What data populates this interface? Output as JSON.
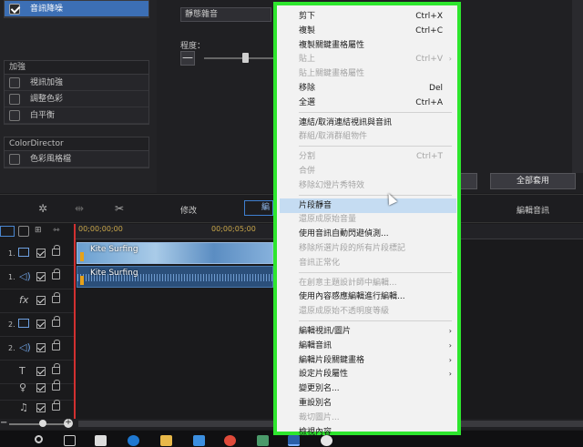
{
  "left_panel": {
    "top_item": "音訊降噪",
    "group_enhance": {
      "title": "加強",
      "items": [
        "視訊加強",
        "調整色彩",
        "白平衡"
      ]
    },
    "group_colordirector": {
      "title": "ColorDirector",
      "items": [
        "色彩風格檔"
      ]
    }
  },
  "settings": {
    "preset_value": "靜態雜音",
    "degree_label": "程度：",
    "minus_label": "—",
    "apply_all_label": "全部套用"
  },
  "toolbar": {
    "modify_label": "修改",
    "tab_edit_label": "編輯",
    "edit_audio_label": "編輯音訊"
  },
  "timeline": {
    "ruler_labels": [
      "00;00;00;00",
      "00;00;05;00"
    ],
    "tracks": [
      {
        "num": "1.",
        "type": "video"
      },
      {
        "num": "1.",
        "type": "audio"
      },
      {
        "num": "",
        "type": "fx"
      },
      {
        "num": "2.",
        "type": "video"
      },
      {
        "num": "2.",
        "type": "audio"
      },
      {
        "num": "",
        "type": "title"
      },
      {
        "num": "",
        "type": "voice"
      },
      {
        "num": "",
        "type": "music"
      }
    ],
    "clip_video_label": "Kite Surfing",
    "clip_audio_label": "Kite Surfing"
  },
  "context_menu": {
    "items": [
      {
        "label": "剪下",
        "shortcut": "Ctrl+X",
        "disabled": false,
        "arrow": false
      },
      {
        "label": "複製",
        "shortcut": "Ctrl+C",
        "disabled": false,
        "arrow": false
      },
      {
        "label": "複製關鍵畫格屬性",
        "shortcut": "",
        "disabled": false,
        "arrow": false
      },
      {
        "label": "貼上",
        "shortcut": "Ctrl+V",
        "disabled": true,
        "arrow": true
      },
      {
        "label": "貼上關鍵畫格屬性",
        "shortcut": "",
        "disabled": true,
        "arrow": false
      },
      {
        "label": "移除",
        "shortcut": "Del",
        "disabled": false,
        "arrow": false
      },
      {
        "label": "全選",
        "shortcut": "Ctrl+A",
        "disabled": false,
        "arrow": false
      },
      {
        "label": "連結/取消連結視訊與音訊",
        "shortcut": "",
        "disabled": false,
        "arrow": false
      },
      {
        "label": "群組/取消群組物件",
        "shortcut": "",
        "disabled": true,
        "arrow": false
      },
      {
        "label": "分割",
        "shortcut": "Ctrl+T",
        "disabled": true,
        "arrow": false
      },
      {
        "label": "合併",
        "shortcut": "",
        "disabled": true,
        "arrow": false
      },
      {
        "label": "移除幻燈片秀特效",
        "shortcut": "",
        "disabled": true,
        "arrow": false
      },
      {
        "label": "片段靜音",
        "shortcut": "",
        "disabled": false,
        "arrow": false,
        "highlight": true
      },
      {
        "label": "還原成原始音量",
        "shortcut": "",
        "disabled": true,
        "arrow": false
      },
      {
        "label": "使用音訊自動閃避偵測...",
        "shortcut": "",
        "disabled": false,
        "arrow": false
      },
      {
        "label": "移除所選片段的所有片段標記",
        "shortcut": "",
        "disabled": true,
        "arrow": false
      },
      {
        "label": "音訊正常化",
        "shortcut": "",
        "disabled": true,
        "arrow": false
      },
      {
        "label": "在創意主題設計師中編輯...",
        "shortcut": "",
        "disabled": true,
        "arrow": false
      },
      {
        "label": "使用內容感應編輯進行編輯...",
        "shortcut": "",
        "disabled": false,
        "arrow": false
      },
      {
        "label": "還原成原始不透明度等級",
        "shortcut": "",
        "disabled": true,
        "arrow": false
      },
      {
        "label": "編輯視訊/圖片",
        "shortcut": "",
        "disabled": false,
        "arrow": true
      },
      {
        "label": "編輯音訊",
        "shortcut": "",
        "disabled": false,
        "arrow": true
      },
      {
        "label": "編輯片段關鍵畫格",
        "shortcut": "",
        "disabled": false,
        "arrow": true
      },
      {
        "label": "設定片段屬性",
        "shortcut": "",
        "disabled": false,
        "arrow": true
      },
      {
        "label": "變更別名...",
        "shortcut": "",
        "disabled": false,
        "arrow": false
      },
      {
        "label": "重設別名",
        "shortcut": "",
        "disabled": false,
        "arrow": false
      },
      {
        "label": "裁切圖片...",
        "shortcut": "",
        "disabled": true,
        "arrow": false
      },
      {
        "label": "檢視內容",
        "shortcut": "",
        "disabled": false,
        "arrow": false
      }
    ]
  },
  "colors": {
    "highlight": "#c5dcf2",
    "menu_border": "#2ee62e",
    "selected_row": "#3c6fb5",
    "playhead": "#d23030"
  }
}
